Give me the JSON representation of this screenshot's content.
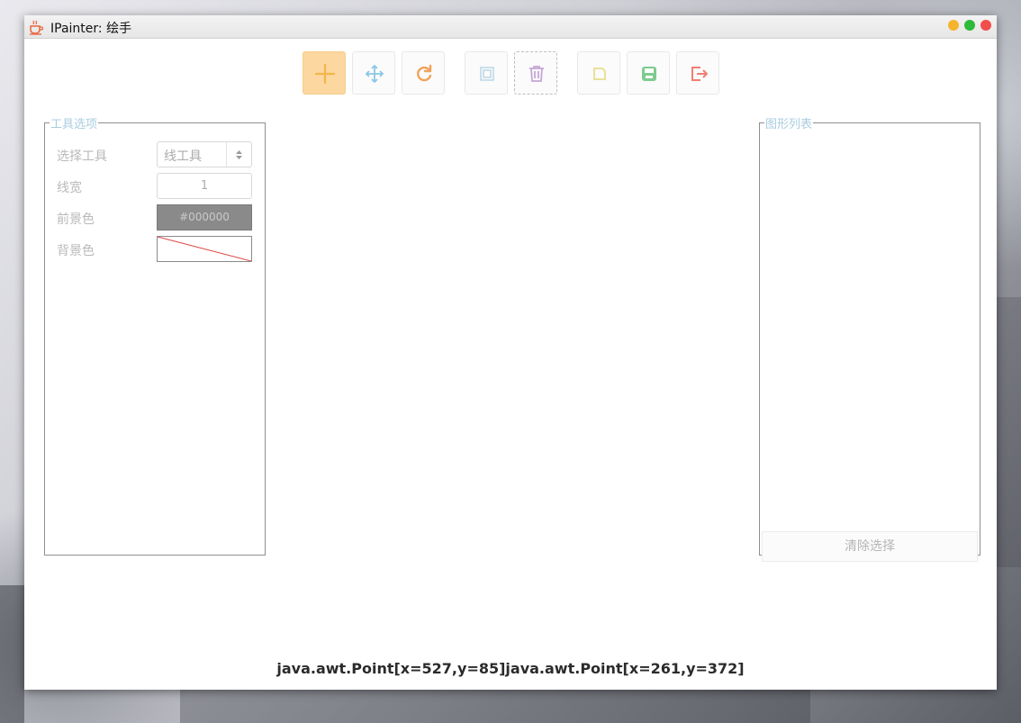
{
  "window": {
    "title": "IPainter: 绘手",
    "controls": [
      "minimize",
      "maximize",
      "close"
    ]
  },
  "toolbar": {
    "buttons": [
      {
        "name": "add-tool-button",
        "icon": "plus-icon",
        "active": true
      },
      {
        "name": "move-tool-button",
        "icon": "move-arrows-icon"
      },
      {
        "name": "rotate-tool-button",
        "icon": "rotate-icon"
      },
      {
        "name": "copy-button",
        "icon": "copy-icon"
      },
      {
        "name": "delete-button",
        "icon": "trash-icon"
      },
      {
        "name": "new-file-button",
        "icon": "new-file-icon"
      },
      {
        "name": "save-button",
        "icon": "save-icon"
      },
      {
        "name": "exit-button",
        "icon": "exit-icon"
      }
    ]
  },
  "tool_options": {
    "legend": "工具选项",
    "select_tool_label": "选择工具",
    "select_tool_value": "线工具",
    "line_width_label": "线宽",
    "line_width_value": "1",
    "foreground_label": "前景色",
    "foreground_value": "#000000",
    "background_label": "背景色"
  },
  "shape_list": {
    "legend": "图形列表",
    "clear_button": "清除选择"
  },
  "status_text": "java.awt.Point[x=527,y=85]java.awt.Point[x=261,y=372]",
  "colors": {
    "active_tool": "#fcd79f",
    "legend_text": "#a9cde0",
    "foreground_swatch": "#8a8a8a",
    "no_color_slash": "#e04040"
  }
}
